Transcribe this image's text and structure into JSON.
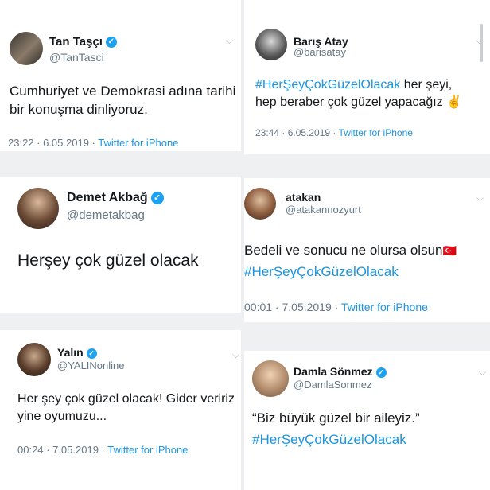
{
  "tweets": [
    {
      "name": "Tan Taşçı",
      "handle": "@TanTasci",
      "verified": true,
      "text_lines": [
        "Cumhuriyet ve Demokrasi adına tarihi",
        "bir konuşma dinliyoruz."
      ],
      "time": "23:22 · 6.05.2019 ·",
      "source": "Twitter for iPhone"
    },
    {
      "name": "Barış Atay",
      "handle": "@barisatay",
      "verified": false,
      "hashtag": "#HerŞeyÇokGüzelOlacak",
      "text_line1_rest": " her şeyi,",
      "text_line2": "hep beraber çok güzel yapacağız ✌",
      "time": "23:44 · 6.05.2019 ·",
      "source": "Twitter for iPhone"
    },
    {
      "name": "Demet Akbağ",
      "handle": "@demetakbag",
      "verified": true,
      "text": "Herşey çok güzel olacak"
    },
    {
      "name": "atakan",
      "handle": "@atakannozyurt",
      "verified": false,
      "text_line1": "Bedeli ve sonucu ne olursa olsun",
      "flag": "🇹🇷",
      "hashtag": "#HerŞeyÇokGüzelOlacak",
      "time": "00:01 · 7.05.2019 ·",
      "source": "Twitter for iPhone"
    },
    {
      "name": "Yalın",
      "handle": "@YALINonline",
      "verified": true,
      "text_lines": [
        "Her şey çok güzel olacak! Gider veririz",
        "yine oyumuzu..."
      ],
      "time": "00:24 · 7.05.2019 ·",
      "source": "Twitter for iPhone"
    },
    {
      "name": "Damla Sönmez",
      "handle": "@DamlaSonmez",
      "verified": true,
      "text_line1": "“Biz büyük güzel bir aileyiz.”",
      "hashtag": "#HerŞeyÇokGüzelOlacak"
    }
  ],
  "icons": {
    "chevron": "chevron-down-icon",
    "verified": "verified-badge-icon"
  },
  "colors": {
    "link": "#1b95e0",
    "verified": "#1da1f2",
    "muted": "#657786"
  }
}
